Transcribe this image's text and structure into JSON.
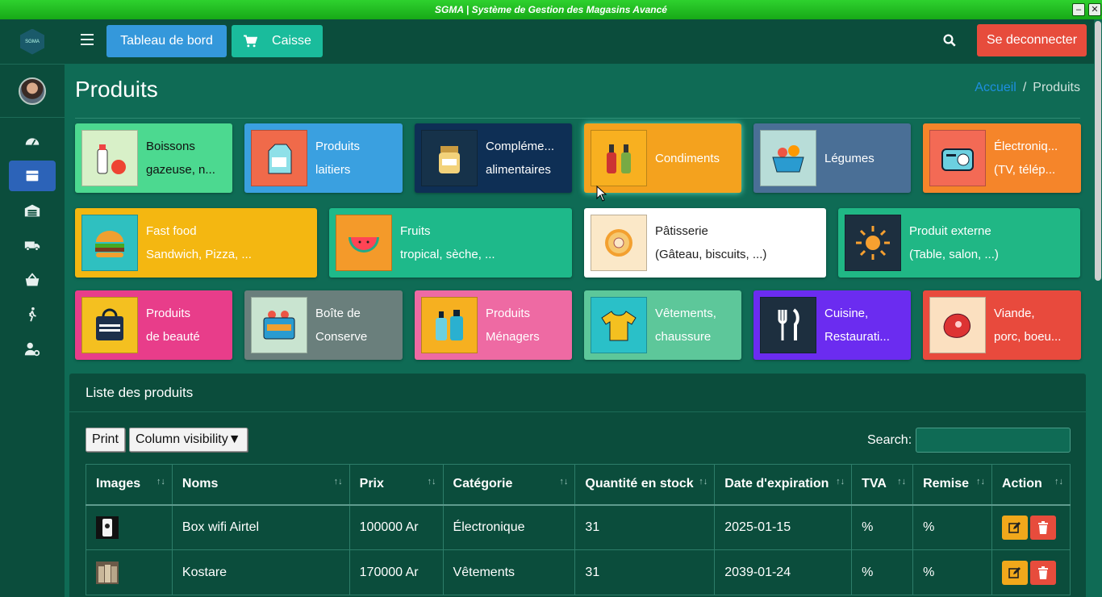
{
  "window": {
    "title": "SGMA | Système de Gestion des Magasins Avancé"
  },
  "sidebar": {
    "brand_text": "SGMA",
    "items": [
      {
        "icon": "dashboard-icon"
      },
      {
        "icon": "box-icon",
        "active": true
      },
      {
        "icon": "warehouse-icon"
      },
      {
        "icon": "truck-icon"
      },
      {
        "icon": "basket-icon"
      },
      {
        "icon": "person-walking-icon"
      },
      {
        "icon": "user-cog-icon"
      }
    ]
  },
  "topbar": {
    "dashboard_label": "Tableau de bord",
    "caisse_label": "Caisse",
    "logout_label": "Se deconnecter"
  },
  "page": {
    "title": "Produits",
    "breadcrumb_home": "Accueil",
    "breadcrumb_current": "Produits"
  },
  "categories": [
    {
      "line1": "Boissons",
      "line2": "gazeuse, n...",
      "color": "#4cd990"
    },
    {
      "line1": "Produits",
      "line2": "laitiers",
      "color": "#3aa0e0"
    },
    {
      "line1": "Compléme...",
      "line2": "alimentaires",
      "color": "#0e2f55"
    },
    {
      "line1": "Condiments",
      "line2": "",
      "color": "#f4a21e"
    },
    {
      "line1": "Légumes",
      "line2": "",
      "color": "#4a6f96"
    },
    {
      "line1": "Électroniq...",
      "line2": "(TV, télép...",
      "color": "#f5852a"
    },
    {
      "line1": "Fast food",
      "line2": "Sandwich, Pizza, ...",
      "color": "#f4b711"
    },
    {
      "line1": "Fruits",
      "line2": "tropical, sèche, ...",
      "color": "#1eb98a"
    },
    {
      "line1": "Pâtisserie",
      "line2": "(Gâteau, biscuits, ...)",
      "color": "#ffffff"
    },
    {
      "line1": "Produit externe",
      "line2": "(Table, salon, ...)",
      "color": "#20b785"
    },
    {
      "line1": "Produits",
      "line2": "de beauté",
      "color": "#e83d8a"
    },
    {
      "line1": "Boîte de",
      "line2": "Conserve",
      "color": "#6a7f7c"
    },
    {
      "line1": "Produits",
      "line2": "Ménagers",
      "color": "#ee6aa3"
    },
    {
      "line1": "Vêtements,",
      "line2": "chaussure",
      "color": "#5dc79a"
    },
    {
      "line1": "Cuisine,",
      "line2": "Restaurati...",
      "color": "#6b2cf0"
    },
    {
      "line1": "Viande,",
      "line2": "porc, boeu...",
      "color": "#e84a3d"
    }
  ],
  "table_panel": {
    "title": "Liste des produits",
    "print_label": "Print",
    "colvis_label": "Column visibility▼",
    "search_label": "Search:",
    "columns": [
      "Images",
      "Noms",
      "Prix",
      "Catégorie",
      "Quantité en stock",
      "Date d'expiration",
      "TVA",
      "Remise",
      "Action"
    ],
    "sort_glyph": "↑↓",
    "rows": [
      {
        "name": "Box wifi Airtel",
        "price": "100000 Ar",
        "category": "Électronique",
        "qty": "31",
        "expiry": "2025-01-15",
        "tva": "%",
        "remise": "%"
      },
      {
        "name": "Kostare",
        "price": "170000 Ar",
        "category": "Vêtements",
        "qty": "31",
        "expiry": "2039-01-24",
        "tva": "%",
        "remise": "%"
      }
    ]
  }
}
